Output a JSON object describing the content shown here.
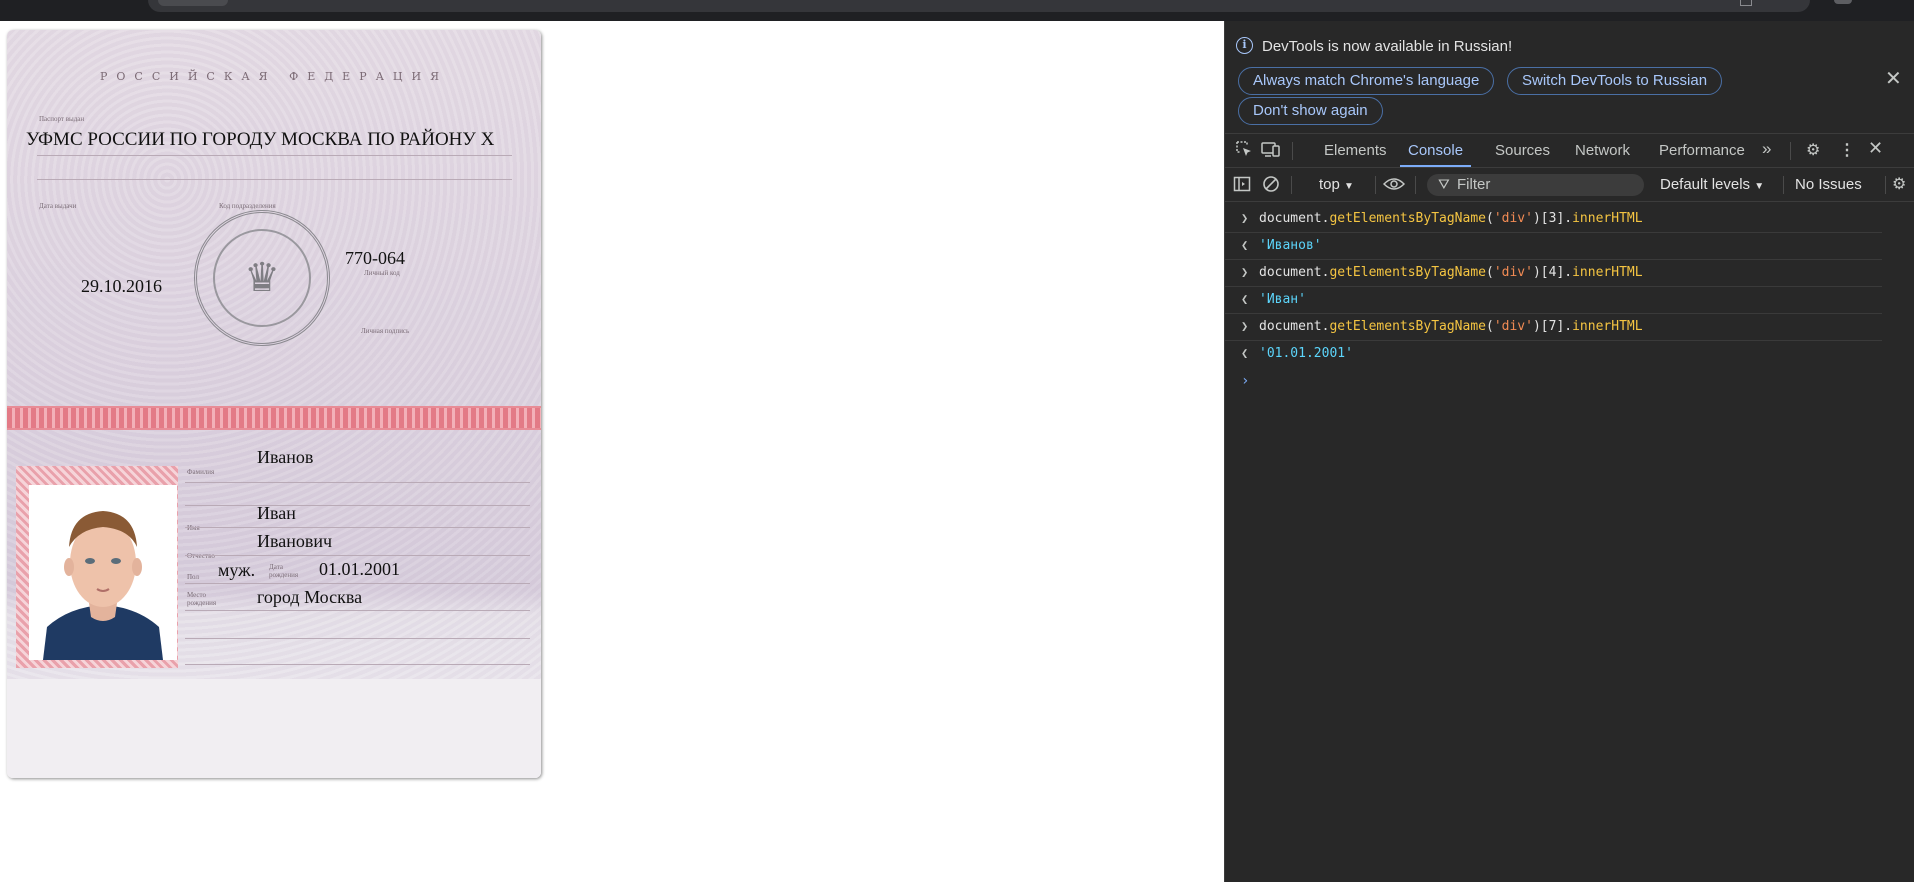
{
  "passport": {
    "country_header": "РОССИЙСКАЯ ФЕДЕРАЦИЯ",
    "issued_by_label": "Паспорт выдан",
    "issued_by": "УФМС РОССИИ ПО ГОРОДУ МОСКВА ПО РАЙОНУ Х",
    "issue_date_label": "Дата выдачи",
    "division_code_label": "Код подразделения",
    "issue_date": "29.10.2016",
    "division_code": "770-064",
    "personal_code_label": "Личный код",
    "signature_label": "Личная подпись",
    "surname_label": "Фамилия",
    "surname": "Иванов",
    "name_label": "Имя",
    "name": "Иван",
    "patronymic_label": "Отчество",
    "patronymic": "Иванович",
    "sex_label": "Пол",
    "sex": "муж.",
    "birth_date_label": "Дата рождения",
    "birth_date": "01.01.2001",
    "birth_place_label": "Место рождения",
    "birth_place": "город Москва",
    "seal_icon": "eagle-emblem"
  },
  "devtools": {
    "info_message": "DevTools is now available in Russian!",
    "btn_match_language": "Always match Chrome's language",
    "btn_switch_russian": "Switch DevTools to Russian",
    "btn_dont_show": "Don't show again",
    "tabs": [
      "Elements",
      "Console",
      "Sources",
      "Network",
      "Performance"
    ],
    "active_tab": "Console",
    "context": "top",
    "filter_placeholder": "Filter",
    "levels": "Default levels",
    "issues": "No Issues",
    "console_entries": [
      {
        "type": "input",
        "obj": "document",
        "method": "getElementsByTagName",
        "arg": "'div'",
        "index": "[3]",
        "prop": "innerHTML"
      },
      {
        "type": "output",
        "value": "'Иванов'"
      },
      {
        "type": "input",
        "obj": "document",
        "method": "getElementsByTagName",
        "arg": "'div'",
        "index": "[4]",
        "prop": "innerHTML"
      },
      {
        "type": "output",
        "value": "'Иван'"
      },
      {
        "type": "input",
        "obj": "document",
        "method": "getElementsByTagName",
        "arg": "'div'",
        "index": "[7]",
        "prop": "innerHTML"
      },
      {
        "type": "output",
        "value": "'01.01.2001'"
      }
    ]
  }
}
